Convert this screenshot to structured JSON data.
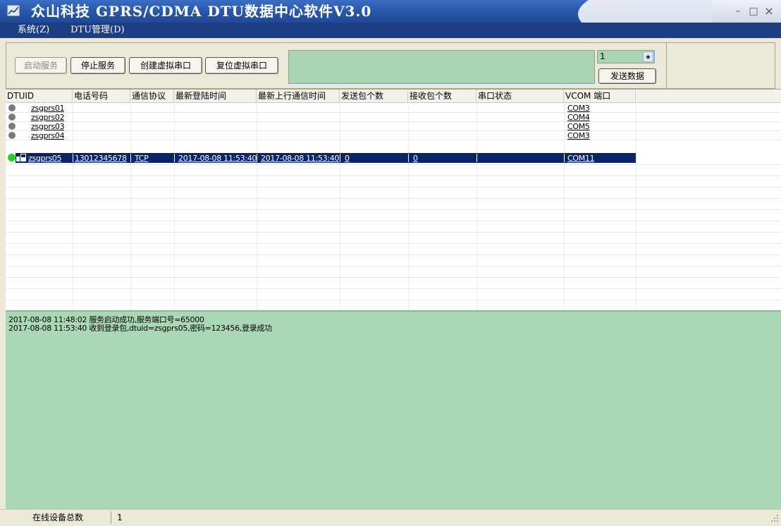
{
  "window": {
    "title": "众山科技 GPRS/CDMA DTU数据中心软件V3.0",
    "minimize_symbol": "–",
    "maximize_symbol": "□",
    "close_symbol": "×"
  },
  "menu": [
    {
      "label": "系统(Z)"
    },
    {
      "label": "DTU管理(D)"
    }
  ],
  "toolbar": {
    "start_service_label": "启动服务",
    "stop_service_label": "停止服务",
    "create_virtual_port_label": "创建虚拟串口",
    "reset_virtual_port_label": "复位虚拟串口",
    "send_input_value": "",
    "select_value": "1",
    "send_data_label": "发送数据"
  },
  "grid": {
    "columns": [
      "DTUID",
      "电话号码",
      "通信协议",
      "最新登陆时间",
      "最新上行通信时间",
      "发送包个数",
      "接收包个数",
      "串口状态",
      "VCOM 端口"
    ],
    "rows": [
      {
        "status": "offline",
        "dtuid": "zsgprs01",
        "phone": "",
        "protocol": "",
        "login_time": "",
        "uplink_time": "",
        "sent": "",
        "received": "",
        "port_status": "",
        "vcom": "COM3"
      },
      {
        "status": "offline",
        "dtuid": "zsgprs02",
        "phone": "",
        "protocol": "",
        "login_time": "",
        "uplink_time": "",
        "sent": "",
        "received": "",
        "port_status": "",
        "vcom": "COM4"
      },
      {
        "status": "offline",
        "dtuid": "zsgprs03",
        "phone": "",
        "protocol": "",
        "login_time": "",
        "uplink_time": "",
        "sent": "",
        "received": "",
        "port_status": "",
        "vcom": "COM5"
      },
      {
        "status": "offline",
        "dtuid": "zsgprs04",
        "phone": "",
        "protocol": "",
        "login_time": "",
        "uplink_time": "",
        "sent": "",
        "received": "",
        "port_status": "",
        "vcom": "COM3"
      },
      {
        "status": "online",
        "dtuid": "zsgprs05",
        "phone": "13012345678",
        "protocol": "TCP",
        "login_time": "2017-08-08 11:53:40",
        "uplink_time": "2017-08-08 11:53:40",
        "sent": "0",
        "received": "0",
        "port_status": "",
        "vcom": "COM11"
      }
    ]
  },
  "log": [
    "2017-08-08 11:48:02 服务启动成功,服务端口号=65000",
    "2017-08-08 11:53:40 收到登录包,dtuid=zsgprs05,密码=123456,登录成功"
  ],
  "statusbar": {
    "online_label": "在线设备总数",
    "online_count": "1"
  },
  "icons": {
    "app": "app-icon",
    "status_online": "green-dot-icon",
    "status_offline": "gray-dot-icon",
    "device": "device-icon",
    "select_arrow": "spin-arrow-icon",
    "grip": "resize-grip-icon"
  },
  "colors": {
    "titlebar": "#2a5aac",
    "menubar": "#1c3d82",
    "send_area": "#a9d5b2",
    "log_background": "#aad7b4",
    "selection": "#0a246a",
    "online": "#22d21f",
    "offline": "#7a7a7a"
  }
}
